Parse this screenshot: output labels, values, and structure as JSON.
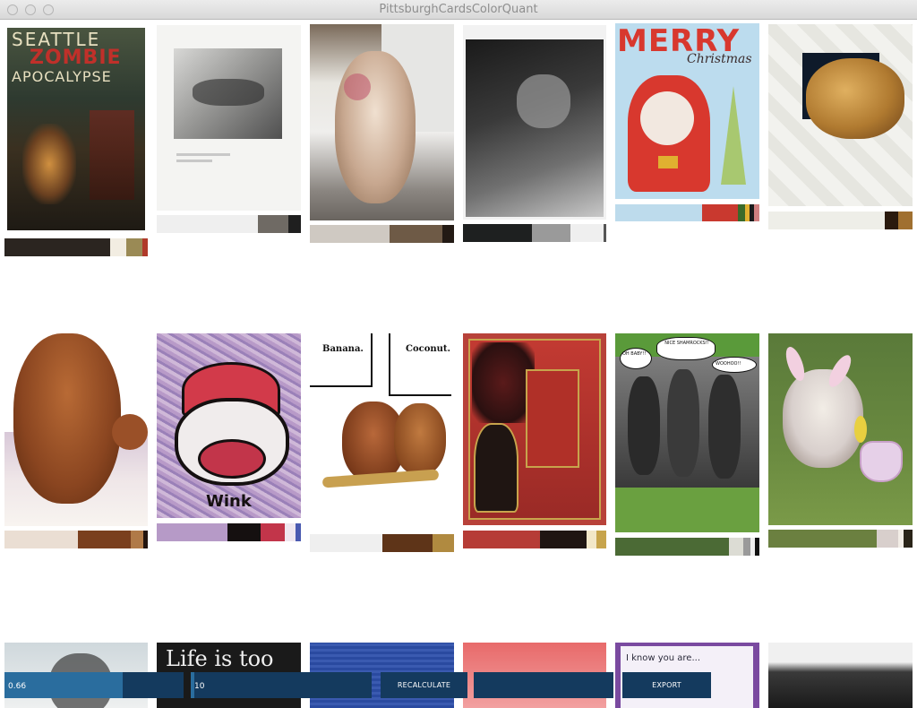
{
  "window": {
    "title": "PittsburghCardsColorQuant"
  },
  "cards": [
    {
      "desc": "seattle-zombie-card",
      "text": [
        "SEATTLE",
        "ZOMBIE",
        "APOCALYPSE"
      ],
      "palette": [
        [
          "#2b2520",
          0.74
        ],
        [
          "#f2ede2",
          0.11
        ],
        [
          "#9a8a55",
          0.11
        ],
        [
          "#b03a2a",
          0.04
        ]
      ]
    },
    {
      "desc": "dachshund-photo-card",
      "palette": [
        [
          "#efefef",
          0.7
        ],
        [
          "#6f6a64",
          0.21
        ],
        [
          "#1f1f1f",
          0.09
        ]
      ]
    },
    {
      "desc": "bulldog-waving-card",
      "palette": [
        [
          "#cfc9c2",
          0.55
        ],
        [
          "#6e5a46",
          0.37
        ],
        [
          "#231a14",
          0.08
        ]
      ]
    },
    {
      "desc": "bw-dog-card",
      "palette": [
        [
          "#1e2020",
          0.48
        ],
        [
          "#9a9a9a",
          0.27
        ],
        [
          "#efefef",
          0.23
        ],
        [
          "#555555",
          0.02
        ]
      ]
    },
    {
      "desc": "merry-christmas-card",
      "text": [
        "MERRY",
        "Christmas"
      ],
      "palette": [
        [
          "#bddbec",
          0.6
        ],
        [
          "#c9392f",
          0.25
        ],
        [
          "#3a6a2a",
          0.05
        ],
        [
          "#e0b030",
          0.03
        ],
        [
          "#1b1b1b",
          0.03
        ],
        [
          "#d08080",
          0.04
        ]
      ]
    },
    {
      "desc": "golden-dog-bones-card",
      "palette": [
        [
          "#eeeee8",
          0.81
        ],
        [
          "#2a1a0e",
          0.09
        ],
        [
          "#a07030",
          0.1
        ]
      ]
    },
    {
      "desc": "dachshund-blanket-card",
      "palette": [
        [
          "#eaded3",
          0.51
        ],
        [
          "#7a3f1e",
          0.37
        ],
        [
          "#b07a48",
          0.09
        ],
        [
          "#231510",
          0.03
        ]
      ]
    },
    {
      "desc": "sock-monkey-card",
      "text": [
        "Wink"
      ],
      "palette": [
        [
          "#b69ac7",
          0.49
        ],
        [
          "#151010",
          0.23
        ],
        [
          "#c2354a",
          0.17
        ],
        [
          "#efe7ef",
          0.07
        ],
        [
          "#4a5ab0",
          0.04
        ]
      ]
    },
    {
      "desc": "two-monkeys-card",
      "text": [
        "Banana.",
        "Coconut."
      ],
      "palette": [
        [
          "#efefef",
          0.5
        ],
        [
          "#5e3418",
          0.35
        ],
        [
          "#b08a40",
          0.15
        ]
      ]
    },
    {
      "desc": "chinese-new-year-card",
      "palette": [
        [
          "#b63c36",
          0.54
        ],
        [
          "#1f1512",
          0.32
        ],
        [
          "#f2e7c8",
          0.07
        ],
        [
          "#c7a44c",
          0.07
        ]
      ]
    },
    {
      "desc": "shamrocks-comic-card",
      "text": [
        "OH BABY!!",
        "NICE SHAMROCKS!!",
        "WOOHOO!!"
      ],
      "palette": [
        [
          "#4b6a35",
          0.79
        ],
        [
          "#dcdcd4",
          0.1
        ],
        [
          "#9a9a9a",
          0.05
        ],
        [
          "#efefef",
          0.03
        ],
        [
          "#111111",
          0.03
        ]
      ]
    },
    {
      "desc": "bunny-bulldog-card",
      "palette": [
        [
          "#6b8040",
          0.75
        ],
        [
          "#d8cfcc",
          0.15
        ],
        [
          "#f2ede6",
          0.04
        ],
        [
          "#2a2418",
          0.06
        ]
      ]
    },
    {
      "desc": "row3-card-1"
    },
    {
      "desc": "life-is-too-card",
      "text": [
        "Life is too"
      ]
    },
    {
      "desc": "row3-card-3"
    },
    {
      "desc": "row3-card-4"
    },
    {
      "desc": "i-know-you-card",
      "text": [
        "I know you are..."
      ]
    },
    {
      "desc": "row3-card-6"
    }
  ],
  "controls": {
    "slider1": {
      "label": "0.66",
      "value": 0.66
    },
    "slider2": {
      "label": "10",
      "value": 0.02
    },
    "recalculate": "RECALCULATE",
    "export": "EXPORT"
  }
}
